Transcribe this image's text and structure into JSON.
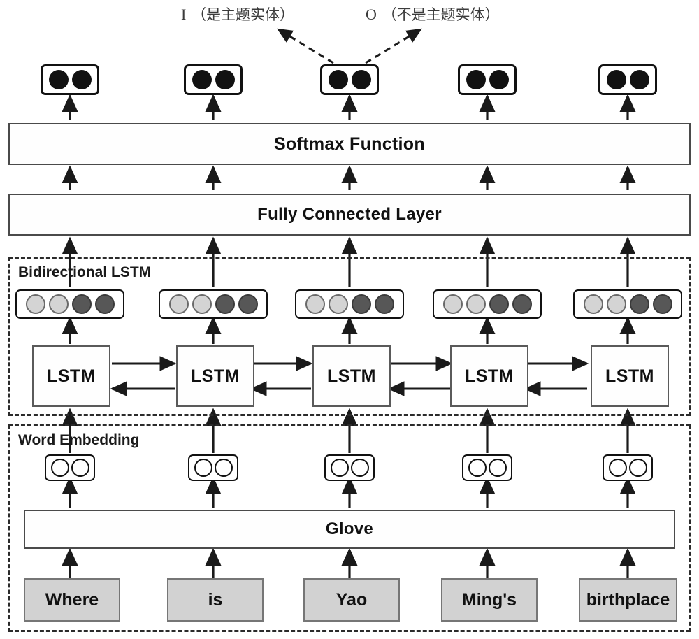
{
  "diagram": {
    "title": "BiLSTM subject-entity tagging architecture",
    "tokens": [
      "Where",
      "is",
      "Yao",
      "Ming's",
      "birthplace"
    ],
    "tag_labels": [
      {
        "symbol": "I",
        "text": "（是主题实体）",
        "name": "tag-label-inside"
      },
      {
        "symbol": "O",
        "text": "（不是主题实体）",
        "name": "tag-label-outside"
      }
    ],
    "layers": {
      "softmax": "Softmax Function",
      "fully_connected": "Fully Connected Layer",
      "bilstm_group": "Bidirectional LSTM",
      "word_embedding_group": "Word Embedding",
      "glove": "Glove",
      "lstm_cell": "LSTM"
    },
    "vectors": {
      "output_state_dots": 2,
      "hidden_state_dots": 4,
      "embedding_dots": 2,
      "hidden_dot_kinds": [
        "light",
        "light",
        "dark",
        "dark"
      ],
      "output_dot_kind": "black",
      "embedding_dot_kind": "white"
    },
    "colors": {
      "output_dot": "#111111",
      "hidden_dot_light": "#d4d4d4",
      "hidden_dot_dark": "#575757",
      "word_box_fill": "#d2d2d2",
      "word_box_border": "#767676",
      "bar_border": "#4a4a4a",
      "group_border": "#2b2b2b",
      "arrow": "#1a1a1a"
    },
    "flow": {
      "lstm_forward": "left-to-right",
      "lstm_backward": "right-to-left",
      "tagged_token_index": 2
    }
  }
}
